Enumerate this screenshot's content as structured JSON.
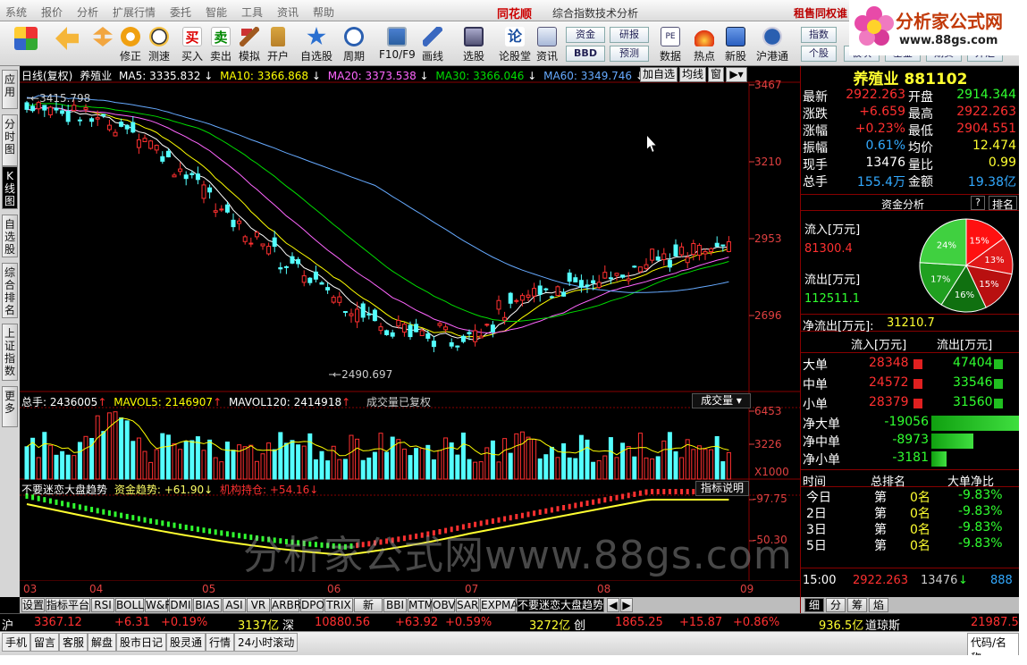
{
  "menu": {
    "items": [
      "系统",
      "报价",
      "分析",
      "扩展行情",
      "委托",
      "智能",
      "工具",
      "资讯",
      "帮助"
    ],
    "app_name": "同花顺",
    "window_title": "综合指数技术分析",
    "promo": "租售同权谁"
  },
  "logo": {
    "text": "分析家公式网",
    "url": "www.88gs.com"
  },
  "toolbar": {
    "buttons": [
      "修正",
      "测速",
      "买入",
      "卖出",
      "模拟",
      "开户",
      "自选股",
      "周期",
      "F10/F9",
      "画线",
      "选股",
      "论股堂",
      "资讯",
      "数据",
      "热点",
      "新股",
      "沪港通"
    ],
    "small": [
      "资金",
      "研报",
      "BBD",
      "预测",
      "指数",
      "个股",
      "板块",
      "基金",
      "期货",
      "外汇"
    ]
  },
  "left_tabs": [
    "应用",
    "分时图",
    "K线图",
    "自选股",
    "综合排名",
    "上证指数",
    "更多"
  ],
  "chart_header": {
    "period": "日线(复权)",
    "name": "养殖业",
    "ma5": "MA5: 3335.832",
    "ma10": "MA10: 3366.868",
    "ma20": "MA20: 3373.538",
    "ma30": "MA30: 3366.046",
    "ma60": "MA60: 3349.746",
    "btn_add": "加自选",
    "btn_ma": "均线",
    "btn_win": "窗"
  },
  "price_axis": [
    "3467",
    "3210",
    "2953",
    "2696"
  ],
  "annotations": {
    "high": "3415.798",
    "low": "2490.697"
  },
  "volume_header": {
    "total": "总手: 2436005",
    "mavol5": "MAVOL5: 2146907",
    "mavol120": "MAVOL120: 2414918",
    "note": "成交量已复权",
    "selector": "成交量"
  },
  "volume_axis": [
    "6453",
    "3226",
    "X1000"
  ],
  "indicator_header": {
    "name": "不要迷恋大盘趋势",
    "fund": "资金趋势: +61.90",
    "inst": "机构持仓: +54.16",
    "btn": "指标说明"
  },
  "indicator_axis": [
    "97.75",
    "50.30"
  ],
  "x_axis": [
    "03",
    "04",
    "05",
    "06",
    "07",
    "08",
    "09"
  ],
  "bottom_tabs": [
    "设置",
    "指标平台",
    "RSI",
    "BOLL",
    "W&R",
    "DMI",
    "BIAS",
    "ASI",
    "VR",
    "ARBR",
    "DPO",
    "TRIX",
    "新DMA",
    "BBI",
    "MTM",
    "OBV",
    "SAR",
    "EXPMA",
    "不要迷恋大盘趋势"
  ],
  "side": {
    "title": "养殖业",
    "code": "881102",
    "quote": [
      [
        "最新",
        "2922.263",
        "开盘",
        "2914.344"
      ],
      [
        "涨跌",
        "+6.659",
        "最高",
        "2922.263"
      ],
      [
        "涨幅",
        "+0.23%",
        "最低",
        "2904.551"
      ],
      [
        "振幅",
        "0.61%",
        "均价",
        "12.474"
      ],
      [
        "现手",
        "13476",
        "量比",
        "0.99"
      ],
      [
        "总手",
        "155.4万",
        "金额",
        "19.38亿"
      ]
    ],
    "fund_title": "资金分析",
    "fund_q": "?",
    "fund_rank": "排名",
    "inflow_label": "流入[万元]",
    "inflow": "81300.4",
    "outflow_label": "流出[万元]",
    "outflow": "112511.1",
    "net_label": "净流出[万元]:",
    "net": "31210.7",
    "pie": [
      {
        "label": "15%",
        "value": 15,
        "color": "#ff1010"
      },
      {
        "label": "13%",
        "value": 13,
        "color": "#e01818"
      },
      {
        "label": "15%",
        "value": 15,
        "color": "#b81010"
      },
      {
        "label": "16%",
        "value": 16,
        "color": "#107010"
      },
      {
        "label": "17%",
        "value": 17,
        "color": "#20a020"
      },
      {
        "label": "24%",
        "value": 24,
        "color": "#40d040"
      }
    ],
    "flow_head": [
      "流入[万元]",
      "流出[万元]"
    ],
    "flow": [
      [
        "大单",
        "28348",
        "47404"
      ],
      [
        "中单",
        "24572",
        "33546"
      ],
      [
        "小单",
        "28379",
        "31560"
      ]
    ],
    "net_flow": [
      [
        "净大单",
        "-19056"
      ],
      [
        "净中单",
        "-8973"
      ],
      [
        "净小单",
        "-3181"
      ]
    ],
    "rank_head": [
      "时间",
      "总排名",
      "大单净比"
    ],
    "rank": [
      [
        "今日",
        "第",
        "0名",
        "-9.83%"
      ],
      [
        "2日",
        "第",
        "0名",
        "-9.83%"
      ],
      [
        "3日",
        "第",
        "0名",
        "-9.83%"
      ],
      [
        "5日",
        "第",
        "0名",
        "-9.83%"
      ]
    ],
    "tick": {
      "time": "15:00",
      "price": "2922.263",
      "vol": "13476",
      "dir": "↓",
      "extra": "888"
    },
    "side_tabs": [
      "细",
      "分",
      "筹",
      "焰"
    ]
  },
  "status": {
    "sh_label": "沪",
    "sh": "3367.12",
    "sh_chg": "+6.31",
    "sh_pct": "+0.19%",
    "sh_amt": "3137亿",
    "sz_label": "深",
    "sz": "10880.56",
    "sz_chg": "+63.92",
    "sz_pct": "+0.59%",
    "sz_amt": "3272亿",
    "cy_label": "创",
    "cy": "1865.25",
    "cy_chg": "+15.87",
    "cy_pct": "+0.86%",
    "cy_amt": "936.5亿",
    "dj_label": "道琼斯",
    "dj": "21987.5"
  },
  "taskbar": [
    "手机",
    "留言",
    "客服",
    "解盘",
    "股市日记",
    "股灵通",
    "行情",
    "24小时滚动"
  ],
  "taskbar_right": "代码/名称",
  "watermark": "分析家公式网www.88gs.com"
}
